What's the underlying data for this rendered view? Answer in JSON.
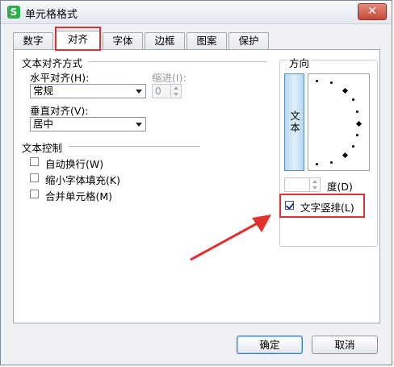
{
  "window": {
    "title": "单元格格式",
    "app_icon": "S",
    "close_label": "✕"
  },
  "tabs": [
    {
      "label": "数字"
    },
    {
      "label": "对齐",
      "active": true
    },
    {
      "label": "字体"
    },
    {
      "label": "边框"
    },
    {
      "label": "图案"
    },
    {
      "label": "保护"
    }
  ],
  "alignment": {
    "section_title": "文本对齐方式",
    "horizontal_label": "水平对齐(H):",
    "horizontal_value": "常规",
    "indent_label": "缩进(I):",
    "indent_value": "0",
    "vertical_label": "垂直对齐(V):",
    "vertical_value": "居中"
  },
  "text_control": {
    "section_title": "文本控制",
    "wrap_text": {
      "label": "自动换行(W)",
      "checked": false
    },
    "shrink_to_fit": {
      "label": "缩小字体填充(K)",
      "checked": false
    },
    "merge_cells": {
      "label": "合并单元格(M)",
      "checked": false
    }
  },
  "orientation": {
    "section_title": "方向",
    "vertical_text_button": "文本",
    "degree_value": "",
    "degree_label": "度(D)",
    "vertical_text_check": {
      "label": "文字竖排(L)",
      "checked": true
    }
  },
  "footer": {
    "ok_label": "确定",
    "cancel_label": "取消"
  },
  "colors": {
    "annotation_red": "#e0312f",
    "accent_blue": "#3b7fc4",
    "app_green": "#2fae4e"
  }
}
